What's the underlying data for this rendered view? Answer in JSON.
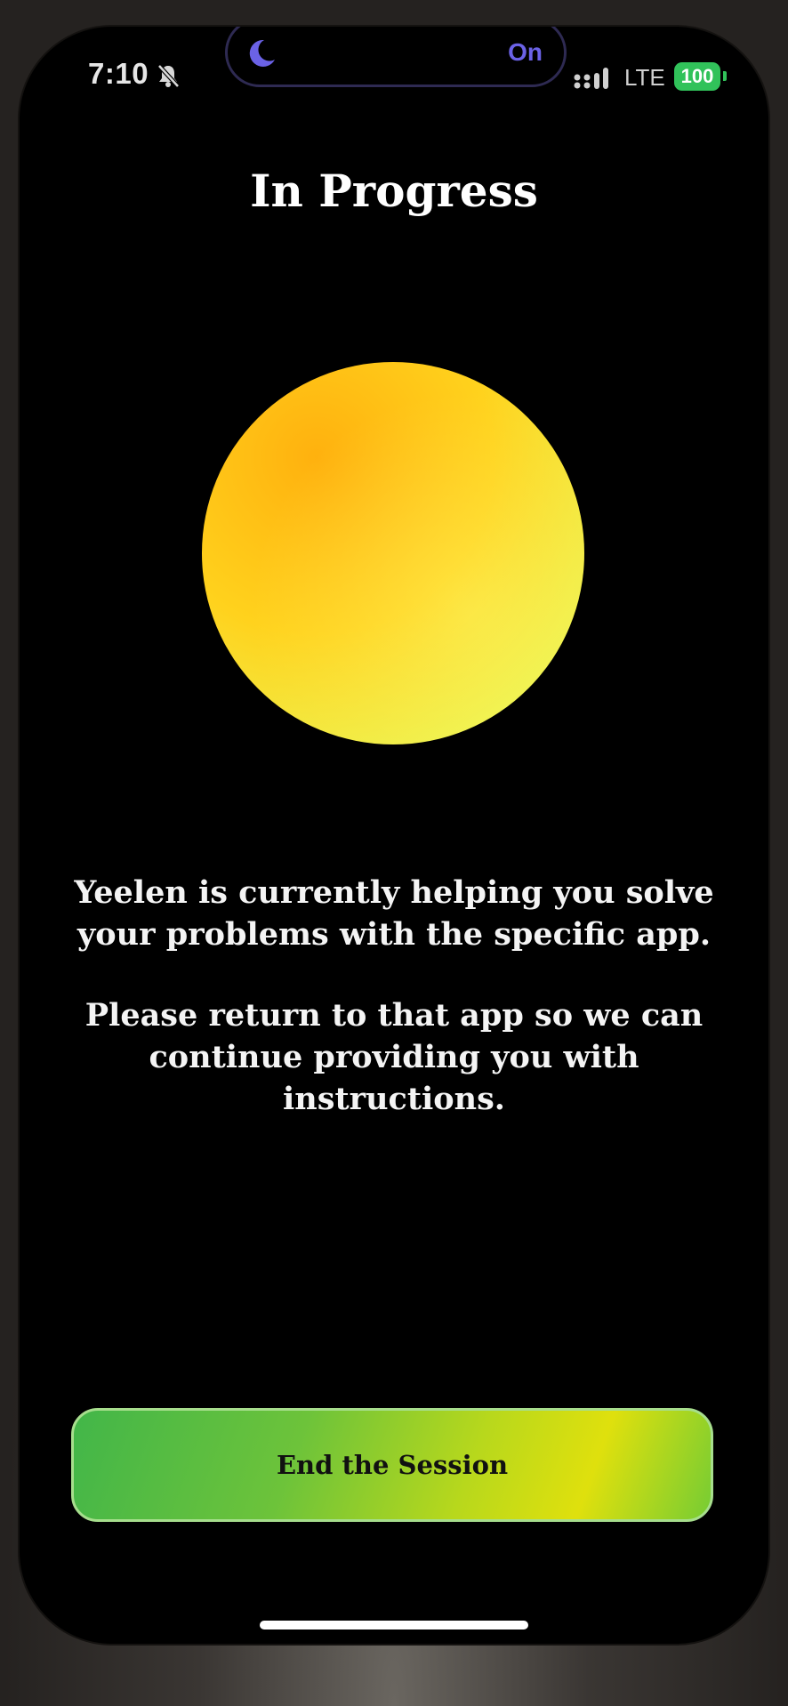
{
  "status_bar": {
    "time": "7:10",
    "focus_state": "On",
    "network": "LTE",
    "battery": "100",
    "focus_icon": "moon-icon",
    "silent_icon": "bell-slash-icon",
    "signal_icon": "cellular-signal-icon"
  },
  "screen": {
    "title": "In Progress",
    "message_primary": "Yeelen is currently helping you solve your problems with the specific app.",
    "message_secondary": "Please return to that app so we can continue providing you with instructions."
  },
  "actions": {
    "end_session_label": "End the Session"
  },
  "colors": {
    "background": "#000000",
    "orb_center": "#ffb10e",
    "orb_edge": "#f3f75a",
    "button_start": "#42b649",
    "button_end": "#dfe00d",
    "focus_accent": "#6b62e6",
    "battery": "#31c25a"
  }
}
